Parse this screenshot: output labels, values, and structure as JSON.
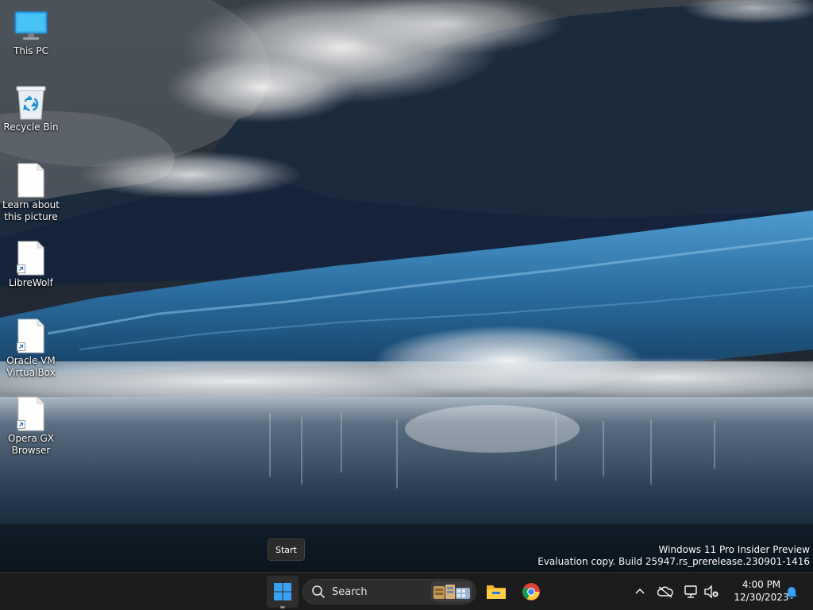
{
  "desktop": {
    "icons": [
      {
        "label": "This PC",
        "icon": "monitor-icon"
      },
      {
        "label": "Recycle Bin",
        "icon": "recycle-bin-icon"
      },
      {
        "label": "Learn about this picture",
        "icon": "document-icon"
      },
      {
        "label": "LibreWolf",
        "icon": "shortcut-file-icon"
      },
      {
        "label": "Oracle VM VirtualBox",
        "icon": "shortcut-file-icon"
      },
      {
        "label": "Opera GX Browser",
        "icon": "shortcut-file-icon"
      }
    ],
    "watermark": {
      "line1": "Windows 11 Pro Insider Preview",
      "line2": "Evaluation copy. Build 25947.rs_prerelease.230901-1416"
    }
  },
  "tooltip": {
    "text": "Start"
  },
  "taskbar": {
    "search_label": "Search",
    "pinned": [
      {
        "name": "File Explorer",
        "icon": "folder-icon"
      },
      {
        "name": "Google Chrome",
        "icon": "chrome-icon"
      }
    ],
    "tray": {
      "icons": [
        "chevron-up-icon",
        "onedrive-offline-icon",
        "network-disconnected-icon",
        "volume-muted-icon",
        "bell-icon"
      ]
    },
    "clock": {
      "time": "4:00 PM",
      "date": "12/30/2023"
    }
  },
  "colors": {
    "taskbar_bg": "#1c1c1c",
    "accent_blue": "#0078d4",
    "start_blue": "#3aa0f3"
  }
}
